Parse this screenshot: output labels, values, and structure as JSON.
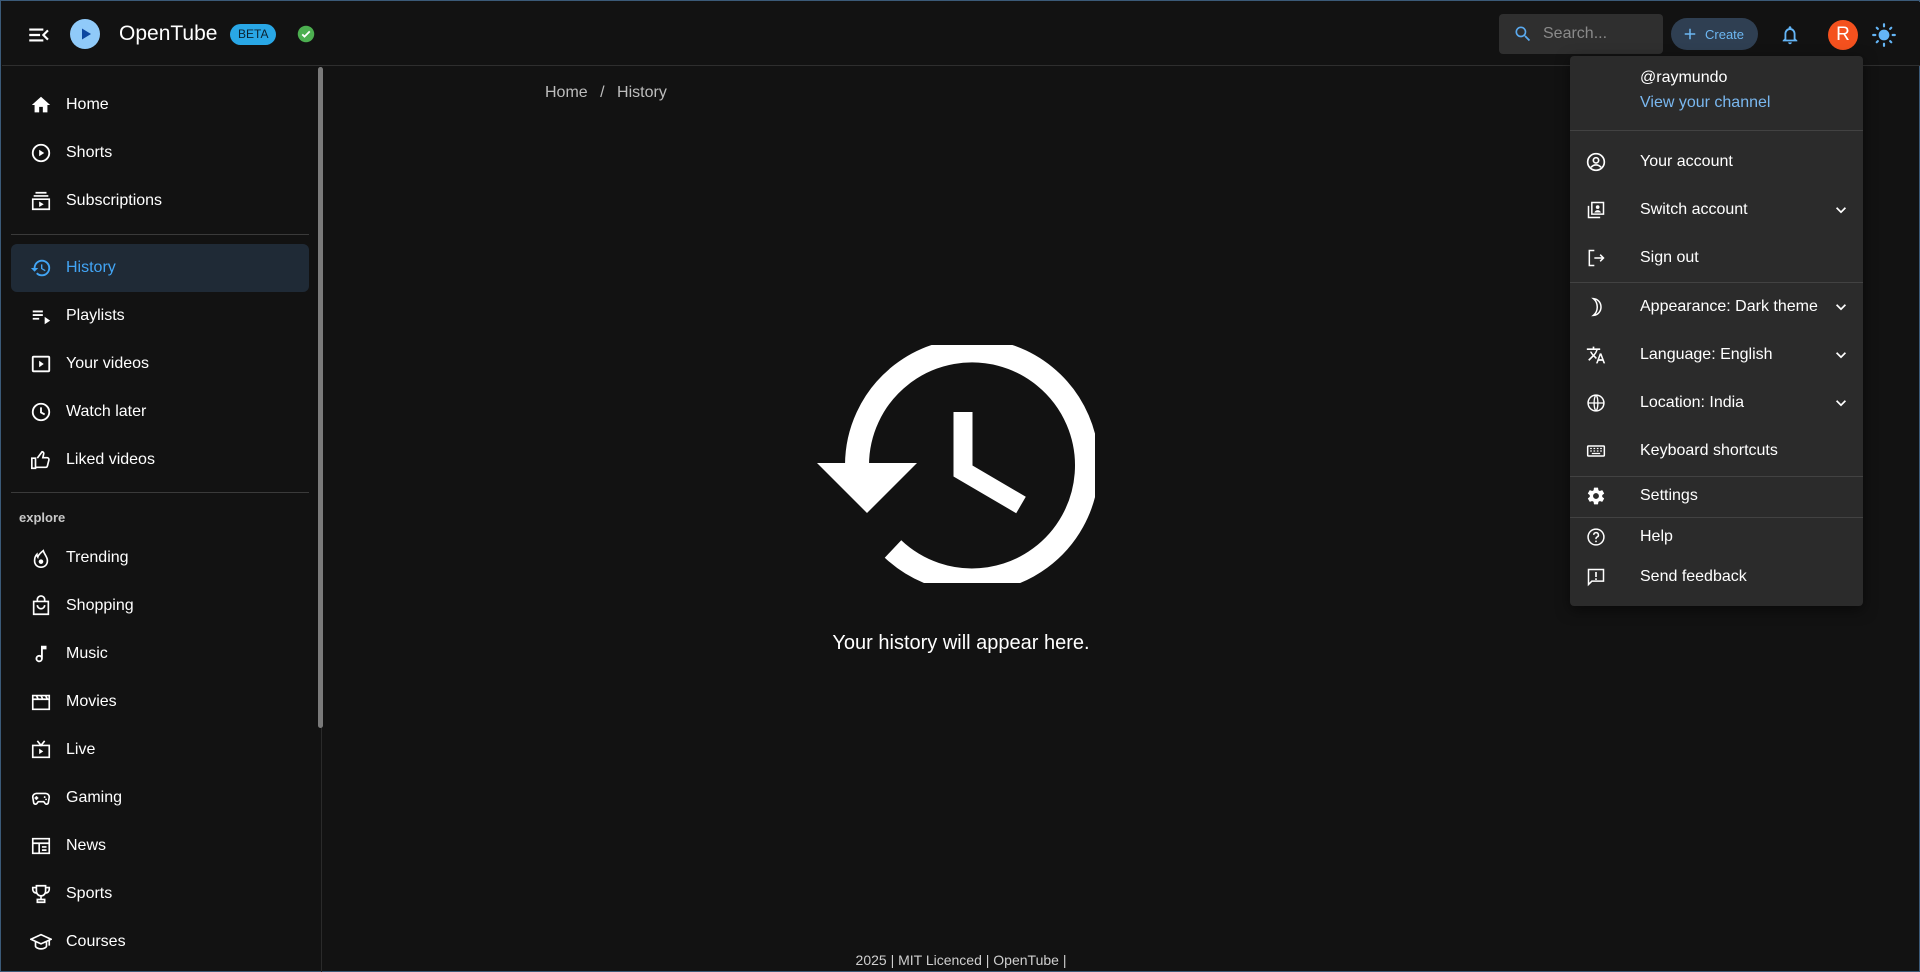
{
  "app": {
    "title": "OpenTube",
    "badge": "BETA"
  },
  "header": {
    "search_placeholder": "Search...",
    "create_label": "Create",
    "avatar_letter": "R"
  },
  "sidebar": {
    "main_items": [
      {
        "label": "Home",
        "icon": "home-icon"
      },
      {
        "label": "Shorts",
        "icon": "shorts-icon"
      },
      {
        "label": "Subscriptions",
        "icon": "subscriptions-icon"
      }
    ],
    "library_items": [
      {
        "label": "History",
        "icon": "history-icon",
        "active": true
      },
      {
        "label": "Playlists",
        "icon": "playlists-icon"
      },
      {
        "label": "Your videos",
        "icon": "your-videos-icon"
      },
      {
        "label": "Watch later",
        "icon": "watch-later-icon"
      },
      {
        "label": "Liked videos",
        "icon": "liked-videos-icon"
      }
    ],
    "explore_heading": "explore",
    "explore_items": [
      {
        "label": "Trending",
        "icon": "trending-icon"
      },
      {
        "label": "Shopping",
        "icon": "shopping-icon"
      },
      {
        "label": "Music",
        "icon": "music-icon"
      },
      {
        "label": "Movies",
        "icon": "movies-icon"
      },
      {
        "label": "Live",
        "icon": "live-icon"
      },
      {
        "label": "Gaming",
        "icon": "gaming-icon"
      },
      {
        "label": "News",
        "icon": "news-icon"
      },
      {
        "label": "Sports",
        "icon": "sports-icon"
      },
      {
        "label": "Courses",
        "icon": "courses-icon"
      }
    ]
  },
  "breadcrumb": {
    "home": "Home",
    "separator": "/",
    "current": "History"
  },
  "main": {
    "empty_message": "Your history will appear here."
  },
  "footer": {
    "text": "2025 | MIT Licenced | OpenTube |"
  },
  "account_menu": {
    "handle": "@raymundo",
    "view_channel": "View your channel",
    "items": [
      {
        "label": "Your account",
        "icon": "account-circle-icon"
      },
      {
        "label": "Switch account",
        "icon": "switch-account-icon",
        "has_submenu": true
      },
      {
        "label": "Sign out",
        "icon": "sign-out-icon"
      },
      {
        "label": "Appearance: Dark theme",
        "icon": "moon-icon",
        "has_submenu": true
      },
      {
        "label": "Language: English",
        "icon": "translate-icon",
        "has_submenu": true
      },
      {
        "label": "Location: India",
        "icon": "globe-icon",
        "has_submenu": true
      },
      {
        "label": "Keyboard shortcuts",
        "icon": "keyboard-icon"
      },
      {
        "label": "Settings",
        "icon": "gear-icon"
      },
      {
        "label": "Help",
        "icon": "help-icon"
      },
      {
        "label": "Send feedback",
        "icon": "feedback-icon"
      }
    ]
  },
  "colors": {
    "background": "#121212",
    "accent": "#42a5f5",
    "beta_badge": "#29a7e6",
    "avatar": "#f4511e",
    "verified": "#4caf50",
    "menu_bg": "#2b2b2b"
  }
}
